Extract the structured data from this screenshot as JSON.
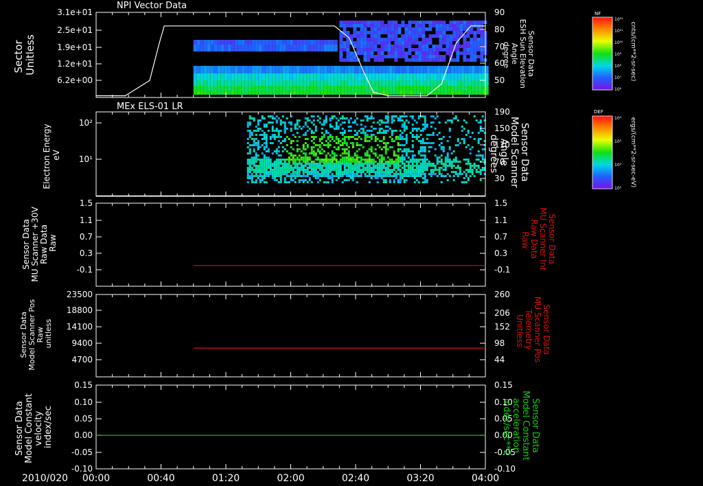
{
  "colors": {
    "background": "#000000",
    "axis": "#ffffff",
    "red": "#e01010",
    "green": "#10d010",
    "white_trace": "#ffffff"
  },
  "date_label": "2010/020",
  "chart_data": [
    {
      "type": "heatmap",
      "title": "NPI Vector Data",
      "ylabel_left": [
        "Sector",
        "Unitless"
      ],
      "ylabel_right": [
        "Sensor Data",
        "ESH Sun Elevation",
        "Angle",
        "degree"
      ],
      "left_ticks": [
        "3.1e+01",
        "2.5e+01",
        "1.9e+01",
        "1.2e+01",
        "6.2e+00"
      ],
      "right_ticks": [
        "90",
        "80",
        "70",
        "60",
        "50"
      ],
      "right_ylim": [
        40,
        90
      ],
      "colorbar": {
        "title": "NF",
        "ticks": [
          "10¹²",
          "10¹¹",
          "10¹⁰",
          "10⁹",
          "10⁸",
          "10⁷",
          "10⁶"
        ],
        "units": "cnts/(cm**2-sr-sec)"
      },
      "trace": {
        "color": "white",
        "x_hours": [
          0.0,
          0.3,
          0.55,
          0.65,
          0.7,
          1.0,
          2.0,
          2.45,
          2.6,
          2.75,
          2.85,
          3.0,
          3.4,
          3.55,
          3.7,
          3.85,
          4.0
        ],
        "y": [
          41,
          41,
          50,
          72,
          82,
          82,
          82,
          82,
          75,
          55,
          43,
          41,
          41,
          48,
          72,
          82,
          82
        ]
      }
    },
    {
      "type": "heatmap",
      "title": "MEx ELS-01 LR",
      "ylabel_left": [
        "Electron Energy",
        "eV"
      ],
      "ylabel_right": [
        "Sensor Data",
        "Model Scanner",
        "Angle",
        "degrees"
      ],
      "left_ticks": [
        "10²",
        "10¹"
      ],
      "right_ticks": [
        "190",
        "150",
        "110",
        "70",
        "30"
      ],
      "right_ylim": [
        0,
        190
      ],
      "colorbar": {
        "title": "DEF",
        "ticks": [
          "10⁴",
          "10³",
          "10²",
          "10¹"
        ],
        "units": "ergs/(cm**2-sr-sec-eV)"
      },
      "trace": {
        "color": "white",
        "x_hours": [
          0.0,
          4.0
        ],
        "y": [
          1,
          1
        ]
      }
    },
    {
      "type": "line",
      "ylabel_left": [
        "Sensor Data",
        "MU Scanner +30V",
        "Raw Data",
        "Raw"
      ],
      "ylabel_right": [
        "Sensor Data",
        "MU Scanner Int",
        "Raw Data",
        "Raw"
      ],
      "left_ticks": [
        "1.5",
        "1.1",
        "0.7",
        "0.3",
        "-0.1"
      ],
      "right_ticks": [
        "1.5",
        "1.1",
        "0.7",
        "0.3",
        "-0.1"
      ],
      "ylim": [
        -0.5,
        1.5
      ],
      "series": [
        {
          "color": "red",
          "x_hours": [
            1.0,
            4.0
          ],
          "y": [
            0.0,
            0.0
          ]
        }
      ]
    },
    {
      "type": "line",
      "ylabel_left": [
        "Sensor Data",
        "Model Scanner Pos",
        "Raw",
        "unitless"
      ],
      "ylabel_right": [
        "Sensor Data",
        "MU Scanner Pos",
        "Telemetry",
        "Unitless"
      ],
      "left_ticks": [
        "23500",
        "18800",
        "14100",
        "9400",
        "4700"
      ],
      "right_ticks": [
        "260",
        "206",
        "152",
        "98",
        "44"
      ],
      "ylim": [
        0,
        23500
      ],
      "series": [
        {
          "color": "red",
          "x_hours": [
            1.0,
            4.0
          ],
          "y": [
            8200,
            8200
          ]
        }
      ]
    },
    {
      "type": "line",
      "ylabel_left": [
        "Sensor Data",
        "Model Constant",
        "velocity",
        "index/sec"
      ],
      "ylabel_right": [
        "Sensor Data",
        "Model Constant",
        "acceleration",
        "index/sec**2"
      ],
      "left_ticks": [
        "0.15",
        "0.10",
        "0.05",
        "0.00",
        "-0.05",
        "-0.10"
      ],
      "right_ticks": [
        "0.15",
        "0.10",
        "0.05",
        "0.00",
        "-0.05",
        "-0.10"
      ],
      "ylim": [
        -0.1,
        0.15
      ],
      "series": [
        {
          "color": "green",
          "x_hours": [
            0.0,
            4.0
          ],
          "y": [
            0.0,
            0.0
          ]
        }
      ]
    }
  ],
  "x_axis": {
    "tick_labels": [
      "00:00",
      "00:40",
      "01:20",
      "02:00",
      "02:40",
      "03:20",
      "04:00"
    ],
    "tick_hours": [
      0,
      0.6667,
      1.3333,
      2.0,
      2.6667,
      3.3333,
      4.0
    ],
    "xlim_hours": [
      0,
      4
    ]
  }
}
